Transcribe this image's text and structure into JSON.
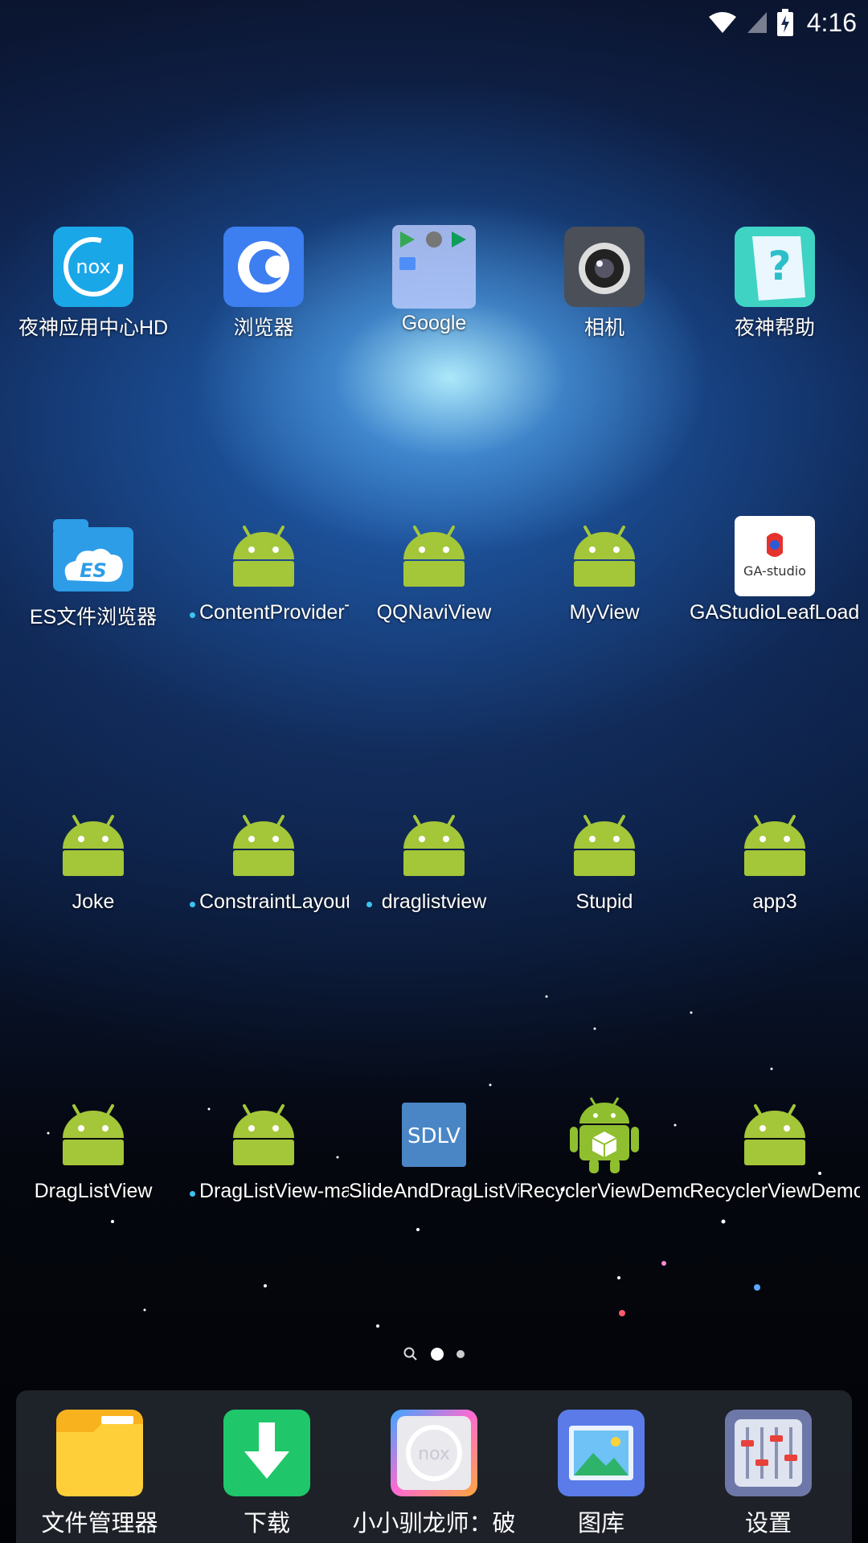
{
  "status_bar": {
    "time": "4:16",
    "icons": [
      "wifi-icon",
      "cell-signal-icon",
      "battery-charging-icon"
    ]
  },
  "apps": [
    {
      "label": "夜神应用中心HD",
      "icon": "nox-app-center-icon",
      "new": false
    },
    {
      "label": "浏览器",
      "icon": "browser-icon",
      "new": false
    },
    {
      "label": "Google",
      "icon": "google-folder-icon",
      "new": false
    },
    {
      "label": "相机",
      "icon": "camera-icon",
      "new": false
    },
    {
      "label": "夜神帮助",
      "icon": "nox-help-icon",
      "new": false
    },
    {
      "label": "ES文件浏览器",
      "icon": "es-file-explorer-icon",
      "new": false
    },
    {
      "label": "ContentProviderT",
      "icon": "android-icon",
      "new": true
    },
    {
      "label": "QQNaviView",
      "icon": "android-icon",
      "new": false
    },
    {
      "label": "MyView",
      "icon": "android-icon",
      "new": false
    },
    {
      "label": "GAStudioLeafLoadi",
      "icon": "ga-studio-icon",
      "new": false
    },
    {
      "label": "Joke",
      "icon": "android-icon",
      "new": false
    },
    {
      "label": "ConstraintLayout",
      "icon": "android-icon",
      "new": true
    },
    {
      "label": "draglistview",
      "icon": "android-icon",
      "new": true
    },
    {
      "label": "Stupid",
      "icon": "android-icon",
      "new": false
    },
    {
      "label": "app3",
      "icon": "android-icon",
      "new": false
    },
    {
      "label": "DragListView",
      "icon": "android-icon",
      "new": false
    },
    {
      "label": "DragListView-ma",
      "icon": "android-icon",
      "new": true
    },
    {
      "label": "SlideAndDragListVi",
      "icon": "sdlv-icon",
      "new": false
    },
    {
      "label": "RecyclerViewDemo",
      "icon": "android-cube-icon",
      "new": false
    },
    {
      "label": "RecyclerViewDemo",
      "icon": "android-icon",
      "new": false
    }
  ],
  "sdlv_text": "SDLV",
  "ga_text": "GA-studio",
  "nox_text": "nox",
  "pager": {
    "pages": 2,
    "current": 1
  },
  "dock": [
    {
      "label": "文件管理器",
      "icon": "folder-icon"
    },
    {
      "label": "下载",
      "icon": "download-icon"
    },
    {
      "label": "小小驯龙师：破",
      "icon": "nox-game-icon"
    },
    {
      "label": "图库",
      "icon": "gallery-icon"
    },
    {
      "label": "设置",
      "icon": "settings-icon"
    }
  ],
  "colors": {
    "android_green": "#A4C639",
    "new_dot": "#3CC4F0"
  }
}
